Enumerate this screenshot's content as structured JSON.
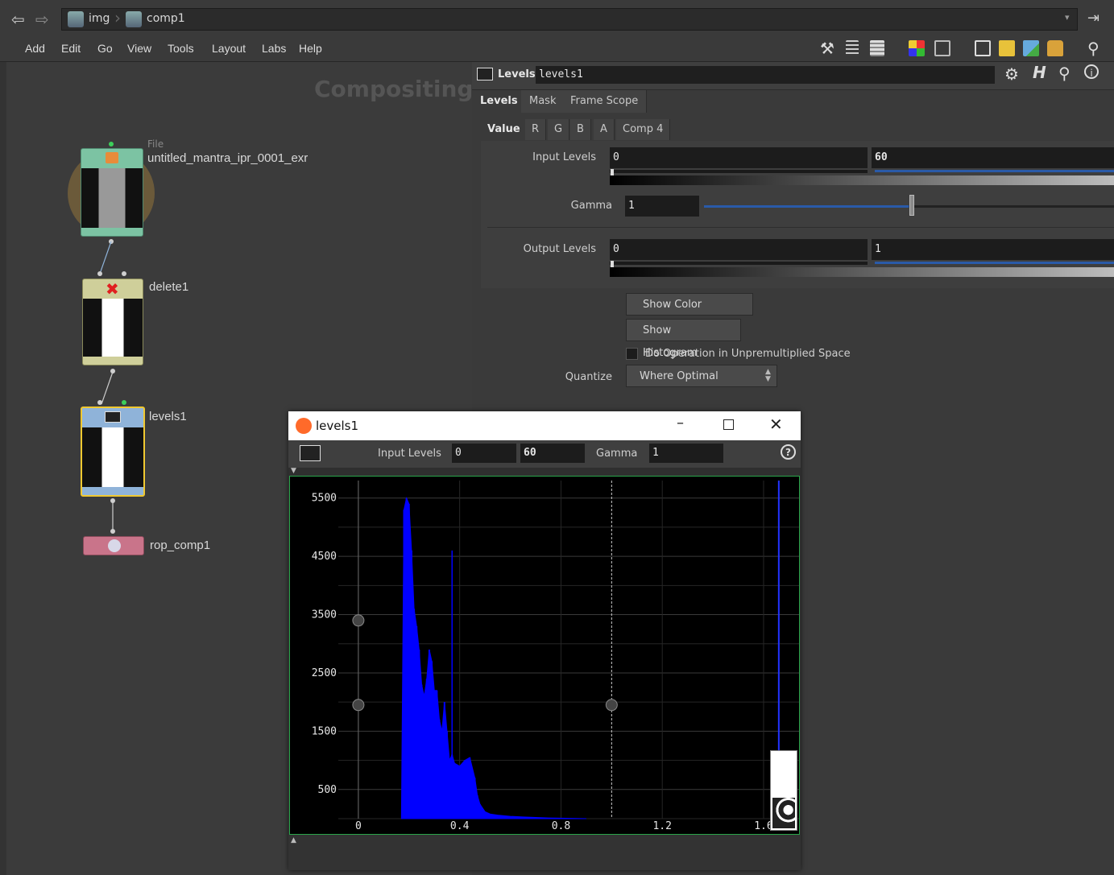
{
  "pathbar": {
    "back_icon": "arrow-left-icon",
    "forward_icon": "arrow-right-icon",
    "crumbs": [
      "img",
      "comp1"
    ]
  },
  "menubar": {
    "items": [
      "Add",
      "Edit",
      "Go",
      "View",
      "Tools",
      "Layout",
      "Labs",
      "Help"
    ]
  },
  "network": {
    "context_label": "Compositing",
    "nodes": [
      {
        "name": "untitled_mantra_ipr_0001_exr",
        "type_label": "File"
      },
      {
        "name": "delete1"
      },
      {
        "name": "levels1"
      },
      {
        "name": "rop_comp1"
      }
    ]
  },
  "parms": {
    "node_type": "Levels",
    "node_name": "levels1",
    "tabs": [
      "Levels",
      "Mask",
      "Frame Scope"
    ],
    "subtabs": [
      "Value",
      "R",
      "G",
      "B",
      "A",
      "Comp 4"
    ],
    "input_levels_label": "Input Levels",
    "input_levels": [
      "0",
      "60"
    ],
    "gamma_label": "Gamma",
    "gamma": "1",
    "output_levels_label": "Output Levels",
    "output_levels": [
      "0",
      "1"
    ],
    "show_color_curves": "Show Color Curves",
    "show_histogram": "Show Histogram",
    "unpremult_label": "Do Operation in Unpremultiplied Space",
    "quantize_label": "Quantize",
    "quantize_value": "Where Optimal"
  },
  "histogram_window": {
    "title": "levels1",
    "input_levels_label": "Input Levels",
    "input_low": "0",
    "input_high": "60",
    "gamma_label": "Gamma",
    "gamma": "1",
    "help_icon": "help-icon",
    "accent": "#0000ff"
  },
  "chart_data": {
    "type": "area",
    "yticks": [
      "5500",
      "4500",
      "3500",
      "2500",
      "1500",
      "500"
    ],
    "xticks": [
      "0",
      "0.4",
      "0.8",
      "1.2",
      "1.6"
    ],
    "ylim": [
      0,
      5800
    ],
    "xlim": [
      -0.27,
      1.74
    ],
    "series": [
      {
        "x": [
          0.17,
          0.18,
          0.19,
          0.2,
          0.21,
          0.22,
          0.23,
          0.24,
          0.25,
          0.26,
          0.27,
          0.28,
          0.29,
          0.3,
          0.31,
          0.32,
          0.33,
          0.34,
          0.35,
          0.36,
          0.37,
          0.38,
          0.4,
          0.42,
          0.44,
          0.46,
          0.47,
          0.48,
          0.5,
          0.52,
          0.55,
          0.6,
          0.65,
          0.7,
          0.75,
          0.8,
          0.9
        ],
        "values": [
          0,
          5300,
          5500,
          5400,
          4600,
          3600,
          3300,
          2900,
          2300,
          2100,
          2400,
          2900,
          2700,
          2200,
          2200,
          1700,
          1500,
          2000,
          1500,
          1000,
          1100,
          950,
          900,
          1000,
          1050,
          700,
          400,
          250,
          120,
          80,
          60,
          40,
          30,
          20,
          12,
          8,
          0
        ]
      }
    ],
    "markers": {
      "input_low": 0,
      "gamma": 1.0,
      "input_high": 1.66
    }
  }
}
